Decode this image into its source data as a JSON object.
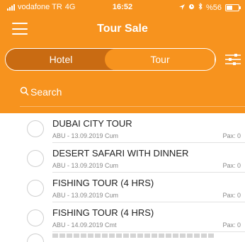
{
  "status_bar": {
    "carrier": "vodafone TR",
    "network": "4G",
    "time": "16:52",
    "battery": "%56",
    "battery_level": 0.56
  },
  "header": {
    "title": "Tour Sale"
  },
  "tabs": [
    {
      "label": "Hotel",
      "selected": false
    },
    {
      "label": "Tour",
      "selected": true
    }
  ],
  "search": {
    "placeholder": "Search"
  },
  "tours": [
    {
      "title": "DUBAI CITY TOUR",
      "subtitle": "ABU - 13.09.2019 Cum",
      "pax": "Pax: 0"
    },
    {
      "title": "DESERT SAFARI WITH DINNER",
      "subtitle": "ABU - 13.09.2019 Cum",
      "pax": "Pax: 0"
    },
    {
      "title": "FISHING TOUR (4 HRS)",
      "subtitle": "ABU - 13.09.2019 Cum",
      "pax": "Pax: 0"
    },
    {
      "title": "FISHING TOUR (4 HRS)",
      "subtitle": "ABU - 14.09.2019 Cmt",
      "pax": "Pax: 0"
    }
  ],
  "colors": {
    "primary": "#f7931e",
    "segment_dark": "#c96b12"
  }
}
